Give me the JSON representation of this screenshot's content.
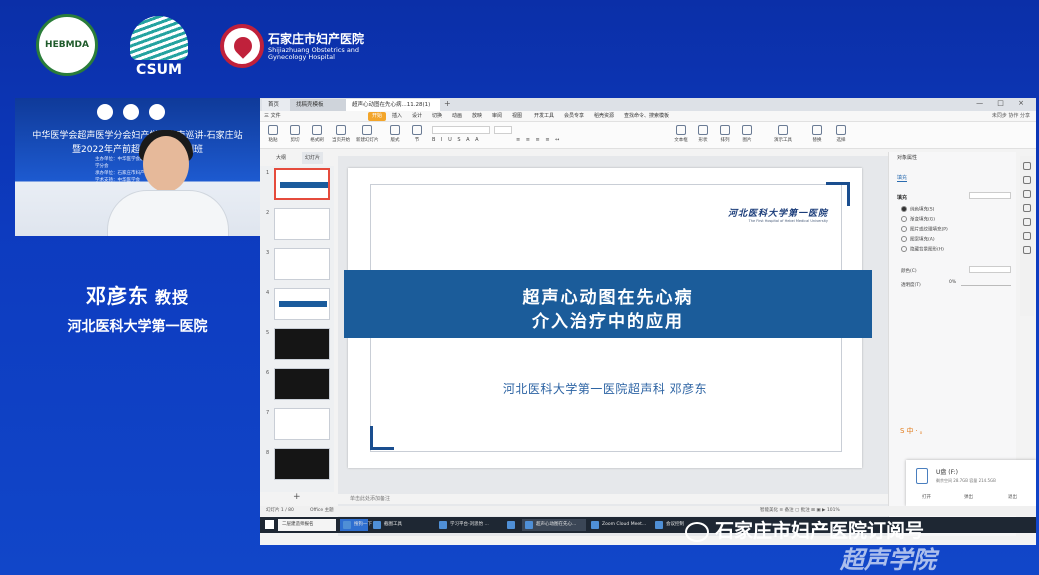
{
  "banner": {
    "hebmda_logo_text": "HEBMDA",
    "csum_logo_text": "CSUM",
    "sjz_hospital_cn": "石家庄市妇产医院",
    "sjz_hospital_en_line1": "Shijiazhuang Obstetrics and",
    "sjz_hospital_en_line2": "Gynecology Hospital"
  },
  "video": {
    "title_line1": "中华医学会超声医学分会妇产学组指南巡讲-石家庄站",
    "title_line2": "暨2022年产前超声规范化培训班",
    "small_text": [
      "主办单位：中华医学会超声医学分会",
      "承办单位：石家庄市妇产医院",
      "学术支持：中华医学会"
    ]
  },
  "speaker": {
    "name": "邓彦东",
    "title": "教授",
    "institution": "河北医科大学第一医院"
  },
  "app": {
    "tabs": [
      {
        "label": "首页"
      },
      {
        "label": "找稿壳模板"
      },
      {
        "label": "超声心动图在先心病...11.28(1)"
      }
    ],
    "window_controls": "— □ ×",
    "menu": {
      "file": "三 文件",
      "items": [
        "开始",
        "插入",
        "设计",
        "切换",
        "动画",
        "放映",
        "审阅",
        "视图",
        "开发工具",
        "会员专享",
        "稻壳资源"
      ],
      "search": "查找命令、搜索模板",
      "right": "未同步 协作 分享"
    },
    "toolbar": {
      "tools": [
        "粘贴",
        "剪切",
        "格式刷",
        "当页开始",
        "新建幻灯片",
        "版式",
        "节",
        "重置",
        "文本框",
        "形状",
        "排列",
        "图片",
        "演示工具",
        "替换",
        "选择"
      ]
    },
    "thumb_tabs": [
      "大纲",
      "幻灯片"
    ],
    "thumb_numbers": [
      "1",
      "2",
      "3",
      "4",
      "5",
      "6",
      "7",
      "8"
    ],
    "notes_hint": "单击此处添加备注",
    "status": {
      "slide_count": "幻灯片 1 / 80",
      "theme": "Office 主题",
      "right": "智能美化   ≡ 备注   ▢ 批注   ⊞   ▣   ▶   101%"
    }
  },
  "slide": {
    "hospital_logo_cn": "河北医科大学第一医院",
    "hospital_logo_en": "The First Hospital of Hebei Medical University",
    "title_line1": "超声心动图在先心病",
    "title_line2": "介入治疗中的应用",
    "subtitle": "河北医科大学第一医院超声科        邓彦东"
  },
  "props_panel": {
    "title": "对象属性",
    "tab": "填充",
    "section": "填充",
    "options": [
      "纯色填充(S)",
      "渐变填充(G)",
      "图片或纹理填充(P)",
      "图案填充(A)",
      "隐藏背景图形(H)"
    ],
    "color_label": "颜色(C)",
    "transparency_label": "透明度(T)",
    "transparency_value": "0%"
  },
  "ime_bar": "S中·。",
  "drive_popup": {
    "name": "U盘 (F:)",
    "info": "剩余空间 28.7GB    容量 214.5GB",
    "actions": [
      "打开",
      "弹出",
      "退出"
    ]
  },
  "taskbar": {
    "search": "二层建造师报名",
    "items": [
      "搜狗一下",
      "截图工具",
      "学习平台-刘思怡 ...",
      "",
      "超声心动图在先心...",
      "Zoom Cloud Meet...",
      "会议控制"
    ],
    "active_index": 4
  },
  "watermark": {
    "line1": "石家庄市妇产医院订阅号",
    "line2": "超声学院"
  }
}
